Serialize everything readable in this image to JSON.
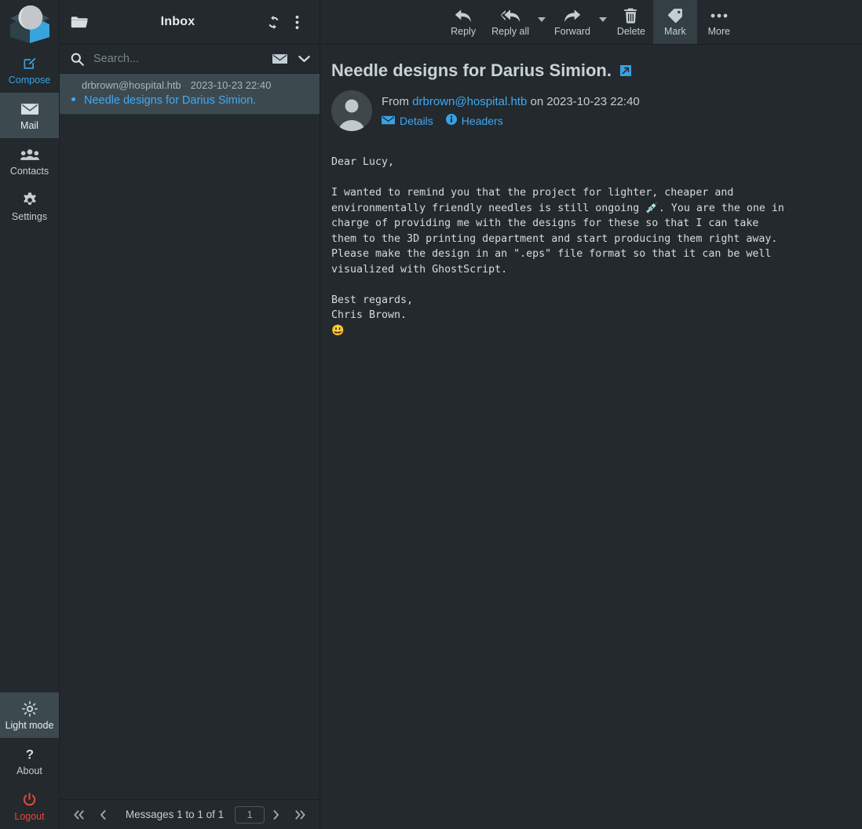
{
  "app": {
    "logo_name": "roundcube-logo",
    "accent": "#3fa9f5",
    "danger": "#e4493b",
    "bg": "#23292c",
    "selected_bg": "#3c4a50"
  },
  "taskmenu": {
    "items": [
      {
        "id": "compose",
        "label": "Compose",
        "icon": "compose-pencil-icon",
        "state": "link"
      },
      {
        "id": "mail",
        "label": "Mail",
        "icon": "envelope-icon",
        "state": "active"
      },
      {
        "id": "contacts",
        "label": "Contacts",
        "icon": "people-icon",
        "state": "normal"
      },
      {
        "id": "settings",
        "label": "Settings",
        "icon": "gear-icon",
        "state": "normal"
      }
    ],
    "bottom_items": [
      {
        "id": "light-mode",
        "label": "Light mode",
        "icon": "sun-icon",
        "state": "active"
      },
      {
        "id": "about",
        "label": "About",
        "icon": "question-mark-icon",
        "state": "normal"
      },
      {
        "id": "logout",
        "label": "Logout",
        "icon": "power-icon",
        "state": "danger"
      }
    ]
  },
  "list": {
    "header": {
      "folder_icon": "folder-icon",
      "title": "Inbox",
      "refresh_icon": "refresh-icon",
      "options_icon": "vertical-dots-icon"
    },
    "search": {
      "icon": "search-icon",
      "placeholder": "Search...",
      "value": "",
      "scope_icon": "envelope-icon",
      "expand_icon": "chevron-down-icon"
    },
    "messages": [
      {
        "from": "drbrown@hospital.htb",
        "date": "2023-10-23 22:40",
        "subject": "Needle designs for Darius Simion.",
        "unread": true,
        "selected": true
      }
    ],
    "footer": {
      "first_icon": "double-chevron-left-icon",
      "prev_icon": "chevron-left-icon",
      "count_text": "Messages 1 to 1 of 1",
      "page_value": "1",
      "next_icon": "chevron-right-icon",
      "last_icon": "double-chevron-right-icon"
    }
  },
  "toolbar": {
    "buttons": [
      {
        "id": "reply",
        "label": "Reply",
        "icon": "reply-arrow-icon",
        "caret": false,
        "active": false
      },
      {
        "id": "reply-all",
        "label": "Reply all",
        "icon": "reply-all-arrow-icon",
        "caret": true,
        "active": false
      },
      {
        "id": "forward",
        "label": "Forward",
        "icon": "forward-arrow-icon",
        "caret": true,
        "active": false
      },
      {
        "id": "delete",
        "label": "Delete",
        "icon": "trash-icon",
        "caret": false,
        "active": false
      },
      {
        "id": "mark",
        "label": "Mark",
        "icon": "tag-icon",
        "caret": false,
        "active": true
      },
      {
        "id": "more",
        "label": "More",
        "icon": "horizontal-dots-icon",
        "caret": false,
        "active": false
      }
    ]
  },
  "message": {
    "subject": "Needle designs for Darius Simion.",
    "open_external_icon": "external-link-icon",
    "avatar_icon": "user-avatar-icon",
    "from_prefix": "From",
    "from_address": "drbrown@hospital.htb",
    "date_prefix": "on",
    "date": "2023-10-23 22:40",
    "details_label": "Details",
    "details_icon": "envelope-icon",
    "headers_label": "Headers",
    "headers_icon": "info-circle-icon",
    "body": "Dear Lucy,\n\nI wanted to remind you that the project for lighter, cheaper and\nenvironmentally friendly needles is still ongoing 💉. You are the one in\ncharge of providing me with the designs for these so that I can take\nthem to the 3D printing department and start producing them right away.\nPlease make the design in an \".eps\" file format so that it can be well\nvisualized with GhostScript.\n\nBest regards,\nChris Brown.\n😃"
  }
}
